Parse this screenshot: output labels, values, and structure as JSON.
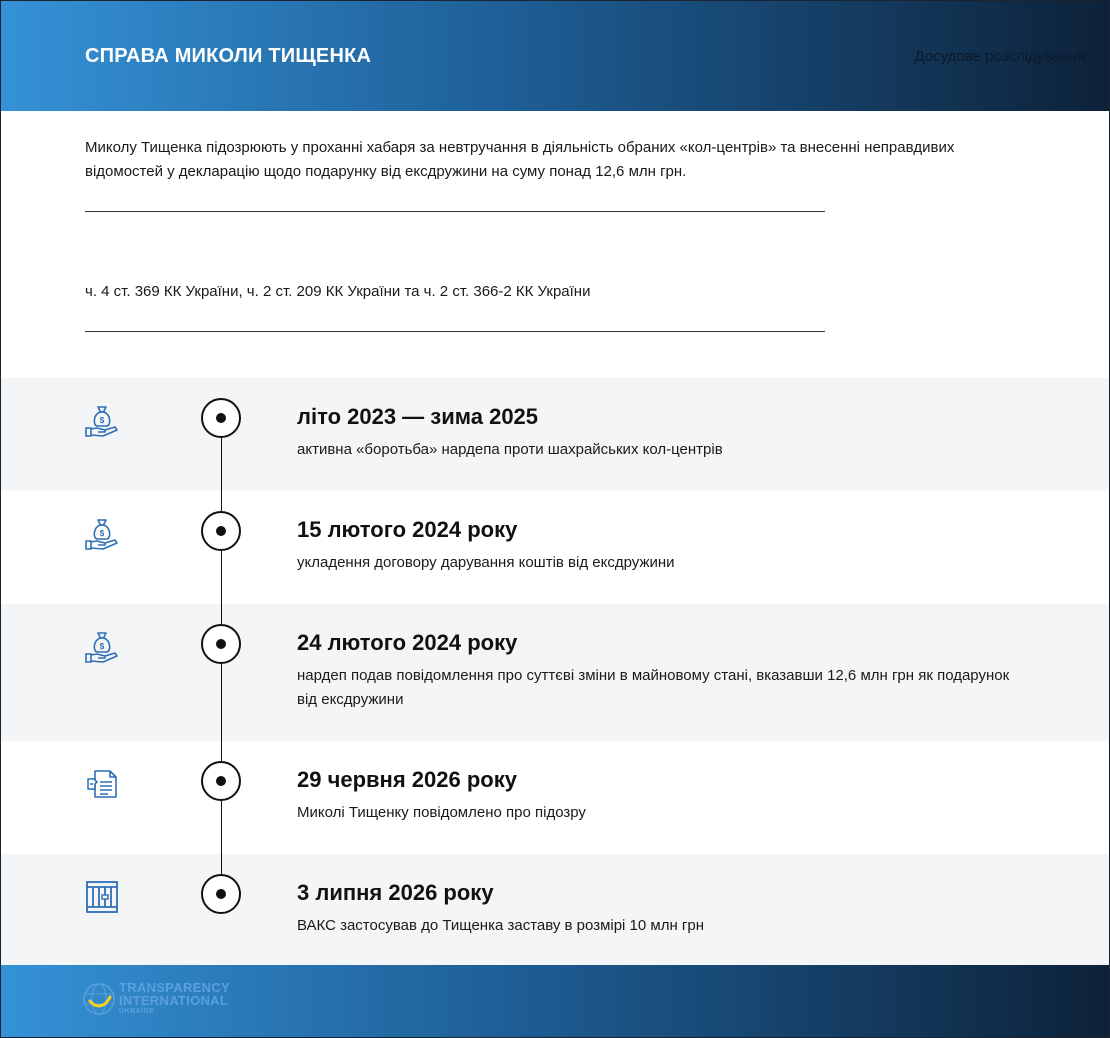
{
  "header": {
    "title": "СПРАВА МИКОЛИ ТИЩЕНКА",
    "subtitle": "Досудове розслідування"
  },
  "intro": {
    "text": "Миколу Тищенка підозрюють у проханні хабаря за невтручання в діяльність обраних «кол-центрів» та внесенні неправдивих відомостей у декларацію щодо подарунку від ексдружини на суму понад 12,6 млн грн.",
    "articles": "ч. 4 ст. 369 КК України, ч. 2 ст. 209 КК України та ч. 2 ст. 366-2 КК України"
  },
  "timeline": [
    {
      "icon": "money-bag-hand-icon",
      "date": "літо 2023 — зима 2025",
      "description": "активна «боротьба» нардепа проти шахрайських кол-центрів"
    },
    {
      "icon": "money-bag-hand-icon",
      "date": "15 лютого 2024 року",
      "description": "укладення договору дарування коштів від ексдружини"
    },
    {
      "icon": "money-bag-hand-icon",
      "date": "24 лютого 2024 року",
      "description": "нардеп подав повідомлення про суттєві зміни в майновому стані, вказавши 12,6 млн грн як подарунок від ексдружини"
    },
    {
      "icon": "documents-icon",
      "date": "29 червня 2026 року",
      "description": "Миколі Тищенку повідомлено про підозру"
    },
    {
      "icon": "prison-bars-icon",
      "date": "3 липня 2026 року",
      "description": "ВАКС застосував до Тищенка заставу в розмірі 10 млн грн"
    }
  ],
  "footer": {
    "logo_line1": "TRANSPARENCY",
    "logo_line2": "INTERNATIONAL",
    "logo_line3": "UKRAINE"
  },
  "colors": {
    "accent": "#3592d6",
    "dark": "#0d2239",
    "icon": "#2f6fb5",
    "shaded_row": "#f4f5f7"
  }
}
